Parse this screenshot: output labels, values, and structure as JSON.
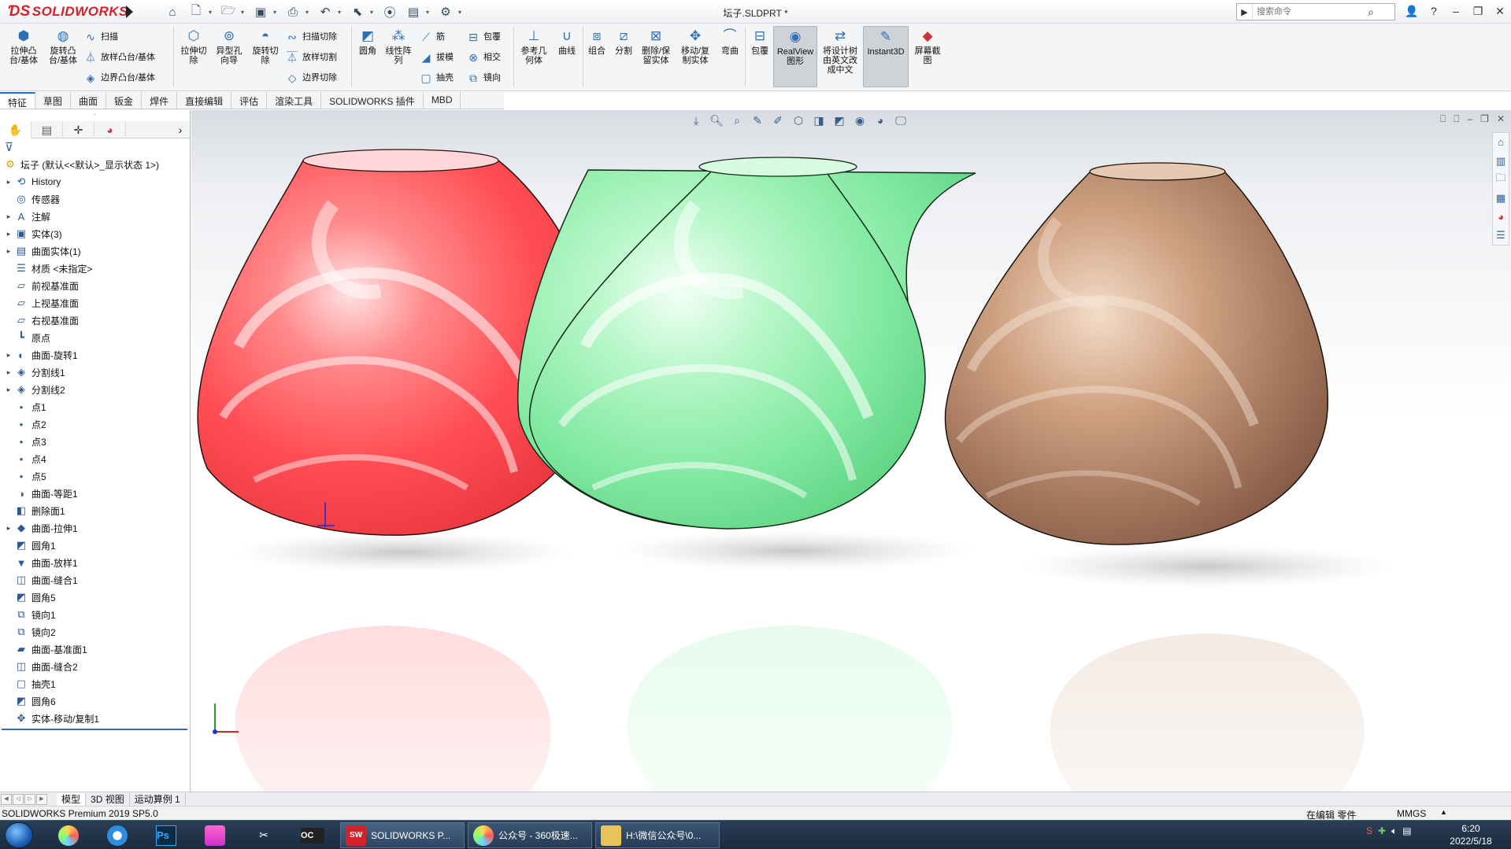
{
  "app": {
    "logo_text": "SOLIDWORKS",
    "document_title": "坛子.SLDPRT *",
    "search_placeholder": "搜索命令"
  },
  "ribbon": {
    "extrude_boss": "拉伸凸\n台/基体",
    "revolve_boss": "旋转凸\n台/基体",
    "sweep": "扫描",
    "loft_boss": "放样凸台/基体",
    "boundary_boss": "边界凸台/基体",
    "extrude_cut": "拉伸切\n除",
    "hole_wizard": "异型孔\n向导",
    "revolve_cut": "旋转切\n除",
    "swept_cut": "扫描切除",
    "lofted_cut": "放样切割",
    "boundary_cut": "边界切除",
    "fillet": "圆角",
    "linear_pattern": "线性阵\n列",
    "rib": "筋",
    "draft": "拔模",
    "shell": "抽壳",
    "wrap": "包覆",
    "intersect": "相交",
    "mirror": "镜向",
    "ref_geometry": "参考几\n何体",
    "curves": "曲线",
    "combine": "组合",
    "split": "分割",
    "delete_keep_body": "删除/保\n留实体",
    "move_copy_body": "移动/复\n制实体",
    "flex": "弯曲",
    "wrap2": "包覆",
    "realview": "RealView\n图形",
    "translate_tree": "将设计树\n由英文改\n成中文",
    "instant3d": "Instant3D",
    "screen_capture": "屏幕截\n图"
  },
  "tabs": [
    "特征",
    "草图",
    "曲面",
    "钣金",
    "焊件",
    "直接编辑",
    "评估",
    "渲染工具",
    "SOLIDWORKS 插件",
    "MBD"
  ],
  "tree": {
    "root": "坛子  (默认<<默认>_显示状态 1>)",
    "items": [
      {
        "label": "History",
        "icon": "history-icon",
        "glyph": "⟲",
        "exp": "▸"
      },
      {
        "label": "传感器",
        "icon": "sensor-icon",
        "glyph": "◎",
        "exp": ""
      },
      {
        "label": "注解",
        "icon": "annotation-icon",
        "glyph": "A",
        "exp": "▸"
      },
      {
        "label": "实体(3)",
        "icon": "solid-bodies-icon",
        "glyph": "▣",
        "exp": "▸"
      },
      {
        "label": "曲面实体(1)",
        "icon": "surface-bodies-icon",
        "glyph": "▤",
        "exp": "▸"
      },
      {
        "label": "材质 <未指定>",
        "icon": "material-icon",
        "glyph": "☰",
        "exp": ""
      },
      {
        "label": "前视基准面",
        "icon": "plane-icon",
        "glyph": "▱",
        "exp": ""
      },
      {
        "label": "上视基准面",
        "icon": "plane-icon",
        "glyph": "▱",
        "exp": ""
      },
      {
        "label": "右视基准面",
        "icon": "plane-icon",
        "glyph": "▱",
        "exp": ""
      },
      {
        "label": "原点",
        "icon": "origin-icon",
        "glyph": "┗",
        "exp": ""
      },
      {
        "label": "曲面-旋转1",
        "icon": "surface-revolve-icon",
        "glyph": "◐",
        "exp": "▸"
      },
      {
        "label": "分割线1",
        "icon": "split-line-icon",
        "glyph": "◈",
        "exp": "▸"
      },
      {
        "label": "分割线2",
        "icon": "split-line-icon",
        "glyph": "◈",
        "exp": "▸"
      },
      {
        "label": "点1",
        "icon": "point-icon",
        "glyph": "●",
        "exp": ""
      },
      {
        "label": "点2",
        "icon": "point-icon",
        "glyph": "●",
        "exp": ""
      },
      {
        "label": "点3",
        "icon": "point-icon",
        "glyph": "●",
        "exp": ""
      },
      {
        "label": "点4",
        "icon": "point-icon",
        "glyph": "●",
        "exp": ""
      },
      {
        "label": "点5",
        "icon": "point-icon",
        "glyph": "●",
        "exp": ""
      },
      {
        "label": "曲面-等距1",
        "icon": "surface-offset-icon",
        "glyph": "◑",
        "exp": ""
      },
      {
        "label": "删除面1",
        "icon": "delete-face-icon",
        "glyph": "◧",
        "exp": ""
      },
      {
        "label": "曲面-拉伸1",
        "icon": "surface-extrude-icon",
        "glyph": "◆",
        "exp": "▸"
      },
      {
        "label": "圆角1",
        "icon": "fillet-icon",
        "glyph": "◩",
        "exp": ""
      },
      {
        "label": "曲面-放样1",
        "icon": "surface-loft-icon",
        "glyph": "▼",
        "exp": ""
      },
      {
        "label": "曲面-缝合1",
        "icon": "surface-knit-icon",
        "glyph": "◫",
        "exp": ""
      },
      {
        "label": "圆角5",
        "icon": "fillet-icon",
        "glyph": "◩",
        "exp": ""
      },
      {
        "label": "镜向1",
        "icon": "mirror-icon",
        "glyph": "⧉",
        "exp": ""
      },
      {
        "label": "镜向2",
        "icon": "mirror-icon",
        "glyph": "⧉",
        "exp": ""
      },
      {
        "label": "曲面-基准面1",
        "icon": "planar-surface-icon",
        "glyph": "▰",
        "exp": ""
      },
      {
        "label": "曲面-缝合2",
        "icon": "surface-knit-icon",
        "glyph": "◫",
        "exp": ""
      },
      {
        "label": "抽壳1",
        "icon": "shell-icon",
        "glyph": "▢",
        "exp": ""
      },
      {
        "label": "圆角6",
        "icon": "fillet-icon",
        "glyph": "◩",
        "exp": ""
      },
      {
        "label": "实体-移动/复制1",
        "icon": "move-copy-icon",
        "glyph": "✥",
        "exp": ""
      }
    ]
  },
  "bottom_tabs": [
    "模型",
    "3D 视图",
    "运动算例 1"
  ],
  "status": {
    "product": "SOLIDWORKS Premium 2019 SP5.0",
    "editing": "在编辑 零件",
    "units": "MMGS"
  },
  "taskbar": {
    "apps": [
      {
        "label": "SOLIDWORKS P...",
        "icon_text": "SW"
      },
      {
        "label": "公众号 - 360极速...",
        "icon_text": ""
      },
      {
        "label": "H:\\微信公众号\\0...",
        "icon_text": ""
      }
    ],
    "time": "6:20",
    "date": "2022/5/18"
  },
  "viewport": {
    "vase_colors": [
      "#ff5a5f",
      "#8ff0ad",
      "#c89a7a"
    ]
  }
}
